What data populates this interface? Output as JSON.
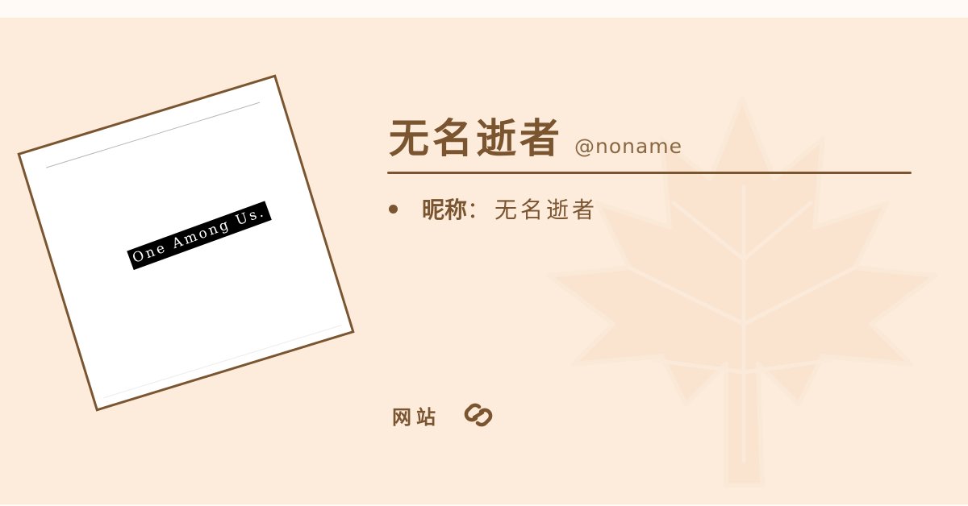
{
  "profile": {
    "name": "无名逝者",
    "handle": "@noname"
  },
  "avatar": {
    "tagline": "One Among Us."
  },
  "info": {
    "items": [
      {
        "label": "昵称",
        "separator": "：",
        "value": "无名逝者"
      }
    ]
  },
  "links": {
    "label": "网站",
    "icon": "link-icon"
  },
  "theme": {
    "background": "#fdecdc",
    "accent": "#7a5530",
    "leaf": "#f5d7c0"
  },
  "decoration": {
    "icon": "maple-leaf-icon"
  }
}
